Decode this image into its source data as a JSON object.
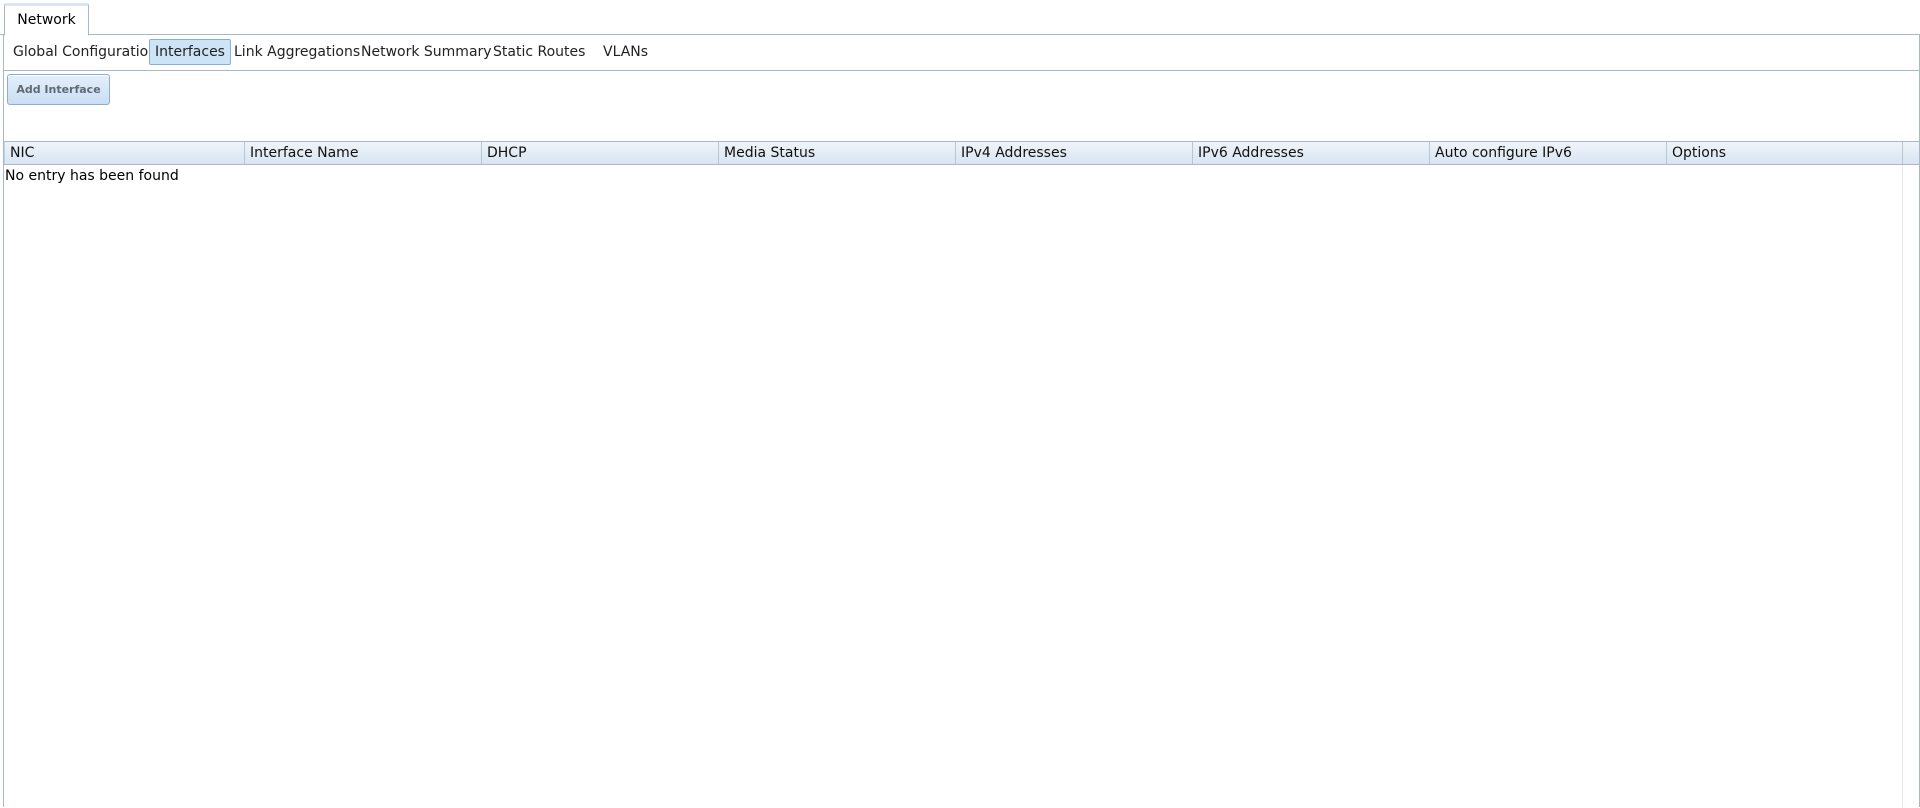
{
  "top_tabs": [
    {
      "label": "Network",
      "active": true
    }
  ],
  "sub_tabs": [
    {
      "label": "Global Configuration",
      "active": false
    },
    {
      "label": "Interfaces",
      "active": true
    },
    {
      "label": "Link Aggregations",
      "active": false
    },
    {
      "label": "Network Summary",
      "active": false
    },
    {
      "label": "Static Routes",
      "active": false
    },
    {
      "label": "VLANs",
      "active": false
    }
  ],
  "toolbar": {
    "add_label": "Add Interface"
  },
  "grid": {
    "columns": [
      "NIC",
      "Interface Name",
      "DHCP",
      "Media Status",
      "IPv4 Addresses",
      "IPv6 Addresses",
      "Auto configure IPv6",
      "Options"
    ],
    "rows": [],
    "empty_message": "No entry has been found"
  },
  "colors": {
    "active_tab_bg": "#cde3f6",
    "border": "#a9b8c8",
    "header_gradient_top": "#eef4fa",
    "header_gradient_bottom": "#d9e5f1"
  }
}
